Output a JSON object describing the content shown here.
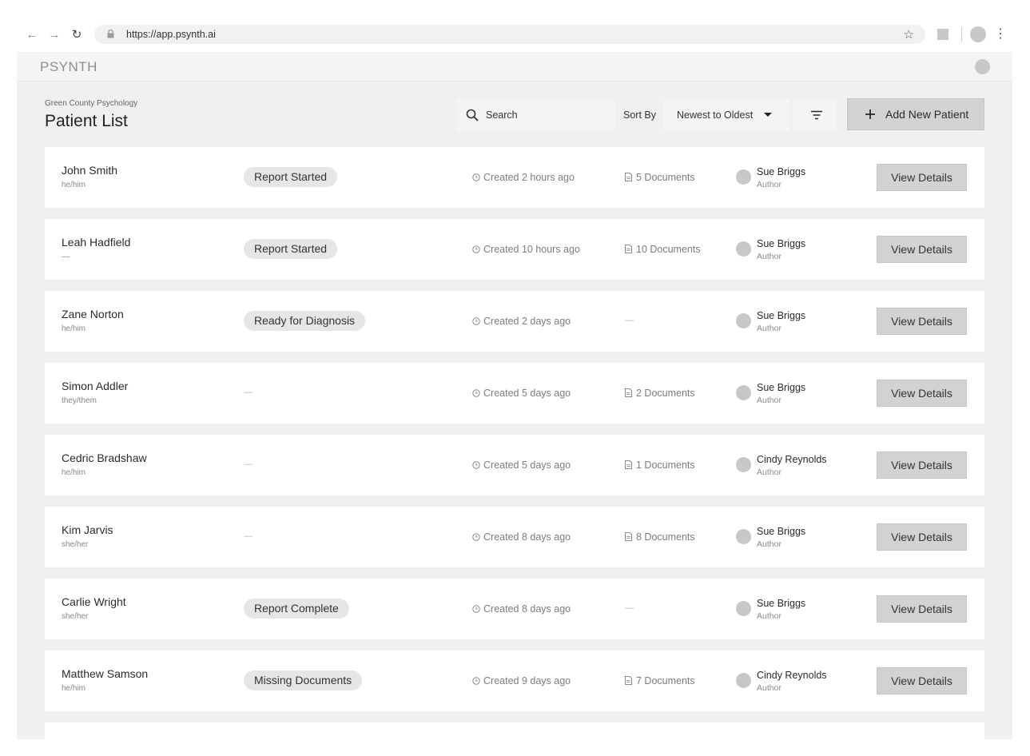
{
  "browser": {
    "url": "https://app.psynth.ai"
  },
  "app": {
    "logo": "PSYNTH"
  },
  "header": {
    "org": "Green County Psychology",
    "title": "Patient List"
  },
  "toolbar": {
    "search_placeholder": "Search",
    "sort_label": "Sort By",
    "sort_value": "Newest to Oldest",
    "add_label": "Add New Patient"
  },
  "patients": [
    {
      "name": "John Smith",
      "pronouns": "he/him",
      "status": "Report Started",
      "created": "Created 2 hours ago",
      "documents": "5 Documents",
      "author": "Sue Briggs",
      "role": "Author",
      "action": "View Details"
    },
    {
      "name": "Leah Hadfield",
      "pronouns": "—",
      "status": "Report Started",
      "created": "Created 10 hours ago",
      "documents": "10 Documents",
      "author": "Sue Briggs",
      "role": "Author",
      "action": "View Details"
    },
    {
      "name": "Zane Norton",
      "pronouns": "he/him",
      "status": "Ready for Diagnosis",
      "created": "Created 2 days ago",
      "documents": "—",
      "author": "Sue Briggs",
      "role": "Author",
      "action": "View Details"
    },
    {
      "name": "Simon Addler",
      "pronouns": "they/them",
      "status": "—",
      "created": "Created 5 days ago",
      "documents": "2 Documents",
      "author": "Sue Briggs",
      "role": "Author",
      "action": "View Details"
    },
    {
      "name": "Cedric Bradshaw",
      "pronouns": "he/him",
      "status": "—",
      "created": "Created 5 days ago",
      "documents": "1 Documents",
      "author": "Cindy Reynolds",
      "role": "Author",
      "action": "View Details"
    },
    {
      "name": "Kim Jarvis",
      "pronouns": "she/her",
      "status": "—",
      "created": "Created 8 days ago",
      "documents": "8 Documents",
      "author": "Sue Briggs",
      "role": "Author",
      "action": "View Details"
    },
    {
      "name": "Carlie Wright",
      "pronouns": "she/her",
      "status": "Report Complete",
      "created": "Created 8 days ago",
      "documents": "—",
      "author": "Sue Briggs",
      "role": "Author",
      "action": "View Details"
    },
    {
      "name": "Matthew Samson",
      "pronouns": "he/him",
      "status": "Missing Documents",
      "created": "Created 9 days ago",
      "documents": "7 Documents",
      "author": "Cindy Reynolds",
      "role": "Author",
      "action": "View Details"
    }
  ]
}
